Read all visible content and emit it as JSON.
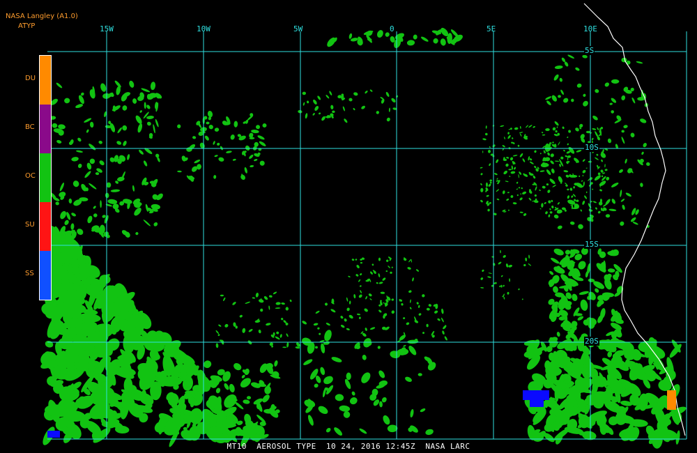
{
  "header": {
    "source": "NASA Langley (A1.0)",
    "product": "ATYP"
  },
  "legend": {
    "items": [
      {
        "label": "DU",
        "color": "#ff8a00"
      },
      {
        "label": "BC",
        "color": "#8a0a8a"
      },
      {
        "label": "OC",
        "color": "#12c312"
      },
      {
        "label": "SU",
        "color": "#ff1414"
      },
      {
        "label": "SS",
        "color": "#1050ff"
      }
    ]
  },
  "grid": {
    "longitudes": [
      "15W",
      "10W",
      "5W",
      "0",
      "5E",
      "10E"
    ],
    "latitudes": [
      "5S",
      "10S",
      "15S",
      "20S"
    ],
    "line_color": "#2fe0e0"
  },
  "colors": {
    "oc_fill": "#12c312",
    "ss_fill": "#0a0aff",
    "du_fill": "#ff8a00",
    "coastline": "#ffffff"
  },
  "footer": {
    "text": "MT10  AEROSOL TYPE  10 24, 2016 12:45Z  NASA LARC"
  }
}
